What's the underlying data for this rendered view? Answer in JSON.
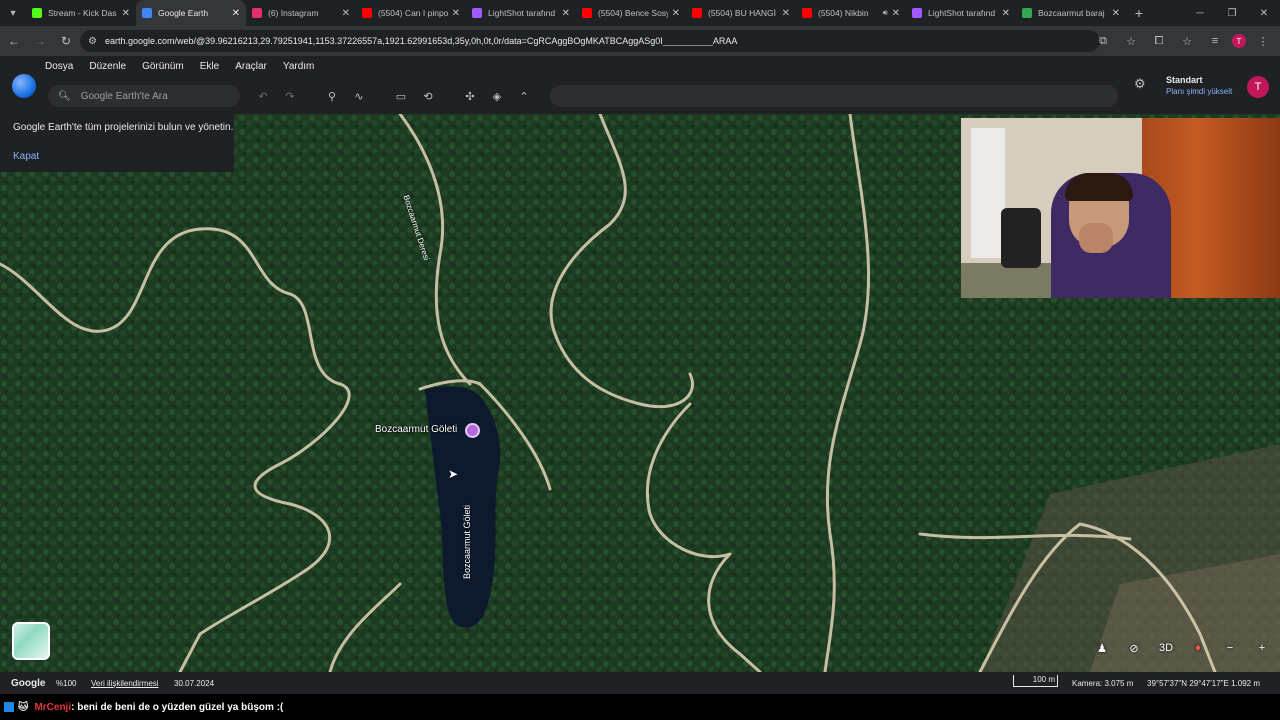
{
  "browser": {
    "tabs": [
      {
        "title": "Stream - Kick Das",
        "color": "#53fc18",
        "active": false,
        "audio": false
      },
      {
        "title": "Google Earth",
        "color": "#4285f4",
        "active": true,
        "audio": false
      },
      {
        "title": "(6) Instagram",
        "color": "#e1306c",
        "active": false,
        "audio": false
      },
      {
        "title": "(5504) Can I pinpo",
        "color": "#ff0000",
        "active": false,
        "audio": false
      },
      {
        "title": "LightShot tarafınd",
        "color": "#a259ff",
        "active": false,
        "audio": false
      },
      {
        "title": "(5504) Bence Sosy",
        "color": "#ff0000",
        "active": false,
        "audio": false
      },
      {
        "title": "(5504) BU HANGİ",
        "color": "#ff0000",
        "active": false,
        "audio": false
      },
      {
        "title": "(5504) Nikbin",
        "color": "#ff0000",
        "active": false,
        "audio": true
      },
      {
        "title": "LightShot tarafınd",
        "color": "#a259ff",
        "active": false,
        "audio": false
      },
      {
        "title": "Bozcaarmut baraj",
        "color": "#34a853",
        "active": false,
        "audio": false
      }
    ],
    "url": "earth.google.com/web/@39.96216213,29.79251941,1153.37226557a,1921.62991653d,35y,0h,0t,0r/data=CgRCAggBOgMKATBCAggASg0I__________ARAA"
  },
  "earth": {
    "menus": [
      "Dosya",
      "Düzenle",
      "Görünüm",
      "Ekle",
      "Araçlar",
      "Yardım"
    ],
    "search_placeholder": "Google Earth'te Ara",
    "plan_title": "Standart",
    "plan_upgrade": "Planı şimdi yükselt",
    "avatar_letter": "T",
    "projects_message": "Google Earth'te tüm projelerinizi bulun ve yönetin.",
    "projects_close": "Kapat",
    "place_label": "Bozcaarmut Göleti",
    "road_label": "Bozcaarmut Deresi",
    "lake_label": "Bozcaarmut Göleti",
    "control_3d": "3D"
  },
  "status": {
    "google": "Google",
    "zoom": "%100",
    "attribution": "Veri ilişkilendirmesi",
    "date": "30.07.2024",
    "scale": "100 m",
    "camera": "Kamera: 3.075 m",
    "coords": "39°57'37\"N 29°47'17\"E 1.092 m"
  },
  "chat": {
    "user": "MrCenji",
    "message": ": beni de beni de o yüzden güzel ya büşom :("
  },
  "colors": {
    "forest": "#1d3a22",
    "road": "#d8cdb0",
    "lake": "#0d1a2e",
    "accent": "#8ab4f8"
  }
}
